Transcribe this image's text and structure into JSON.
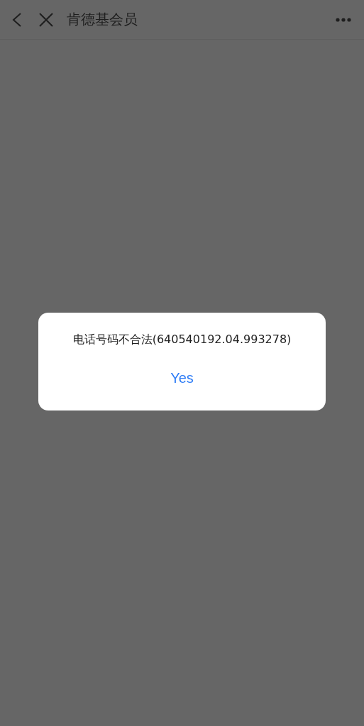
{
  "header": {
    "title": "肯德基会员"
  },
  "dialog": {
    "message": "电话号码不合法(640540192.04.993278)",
    "button": "Yes"
  }
}
